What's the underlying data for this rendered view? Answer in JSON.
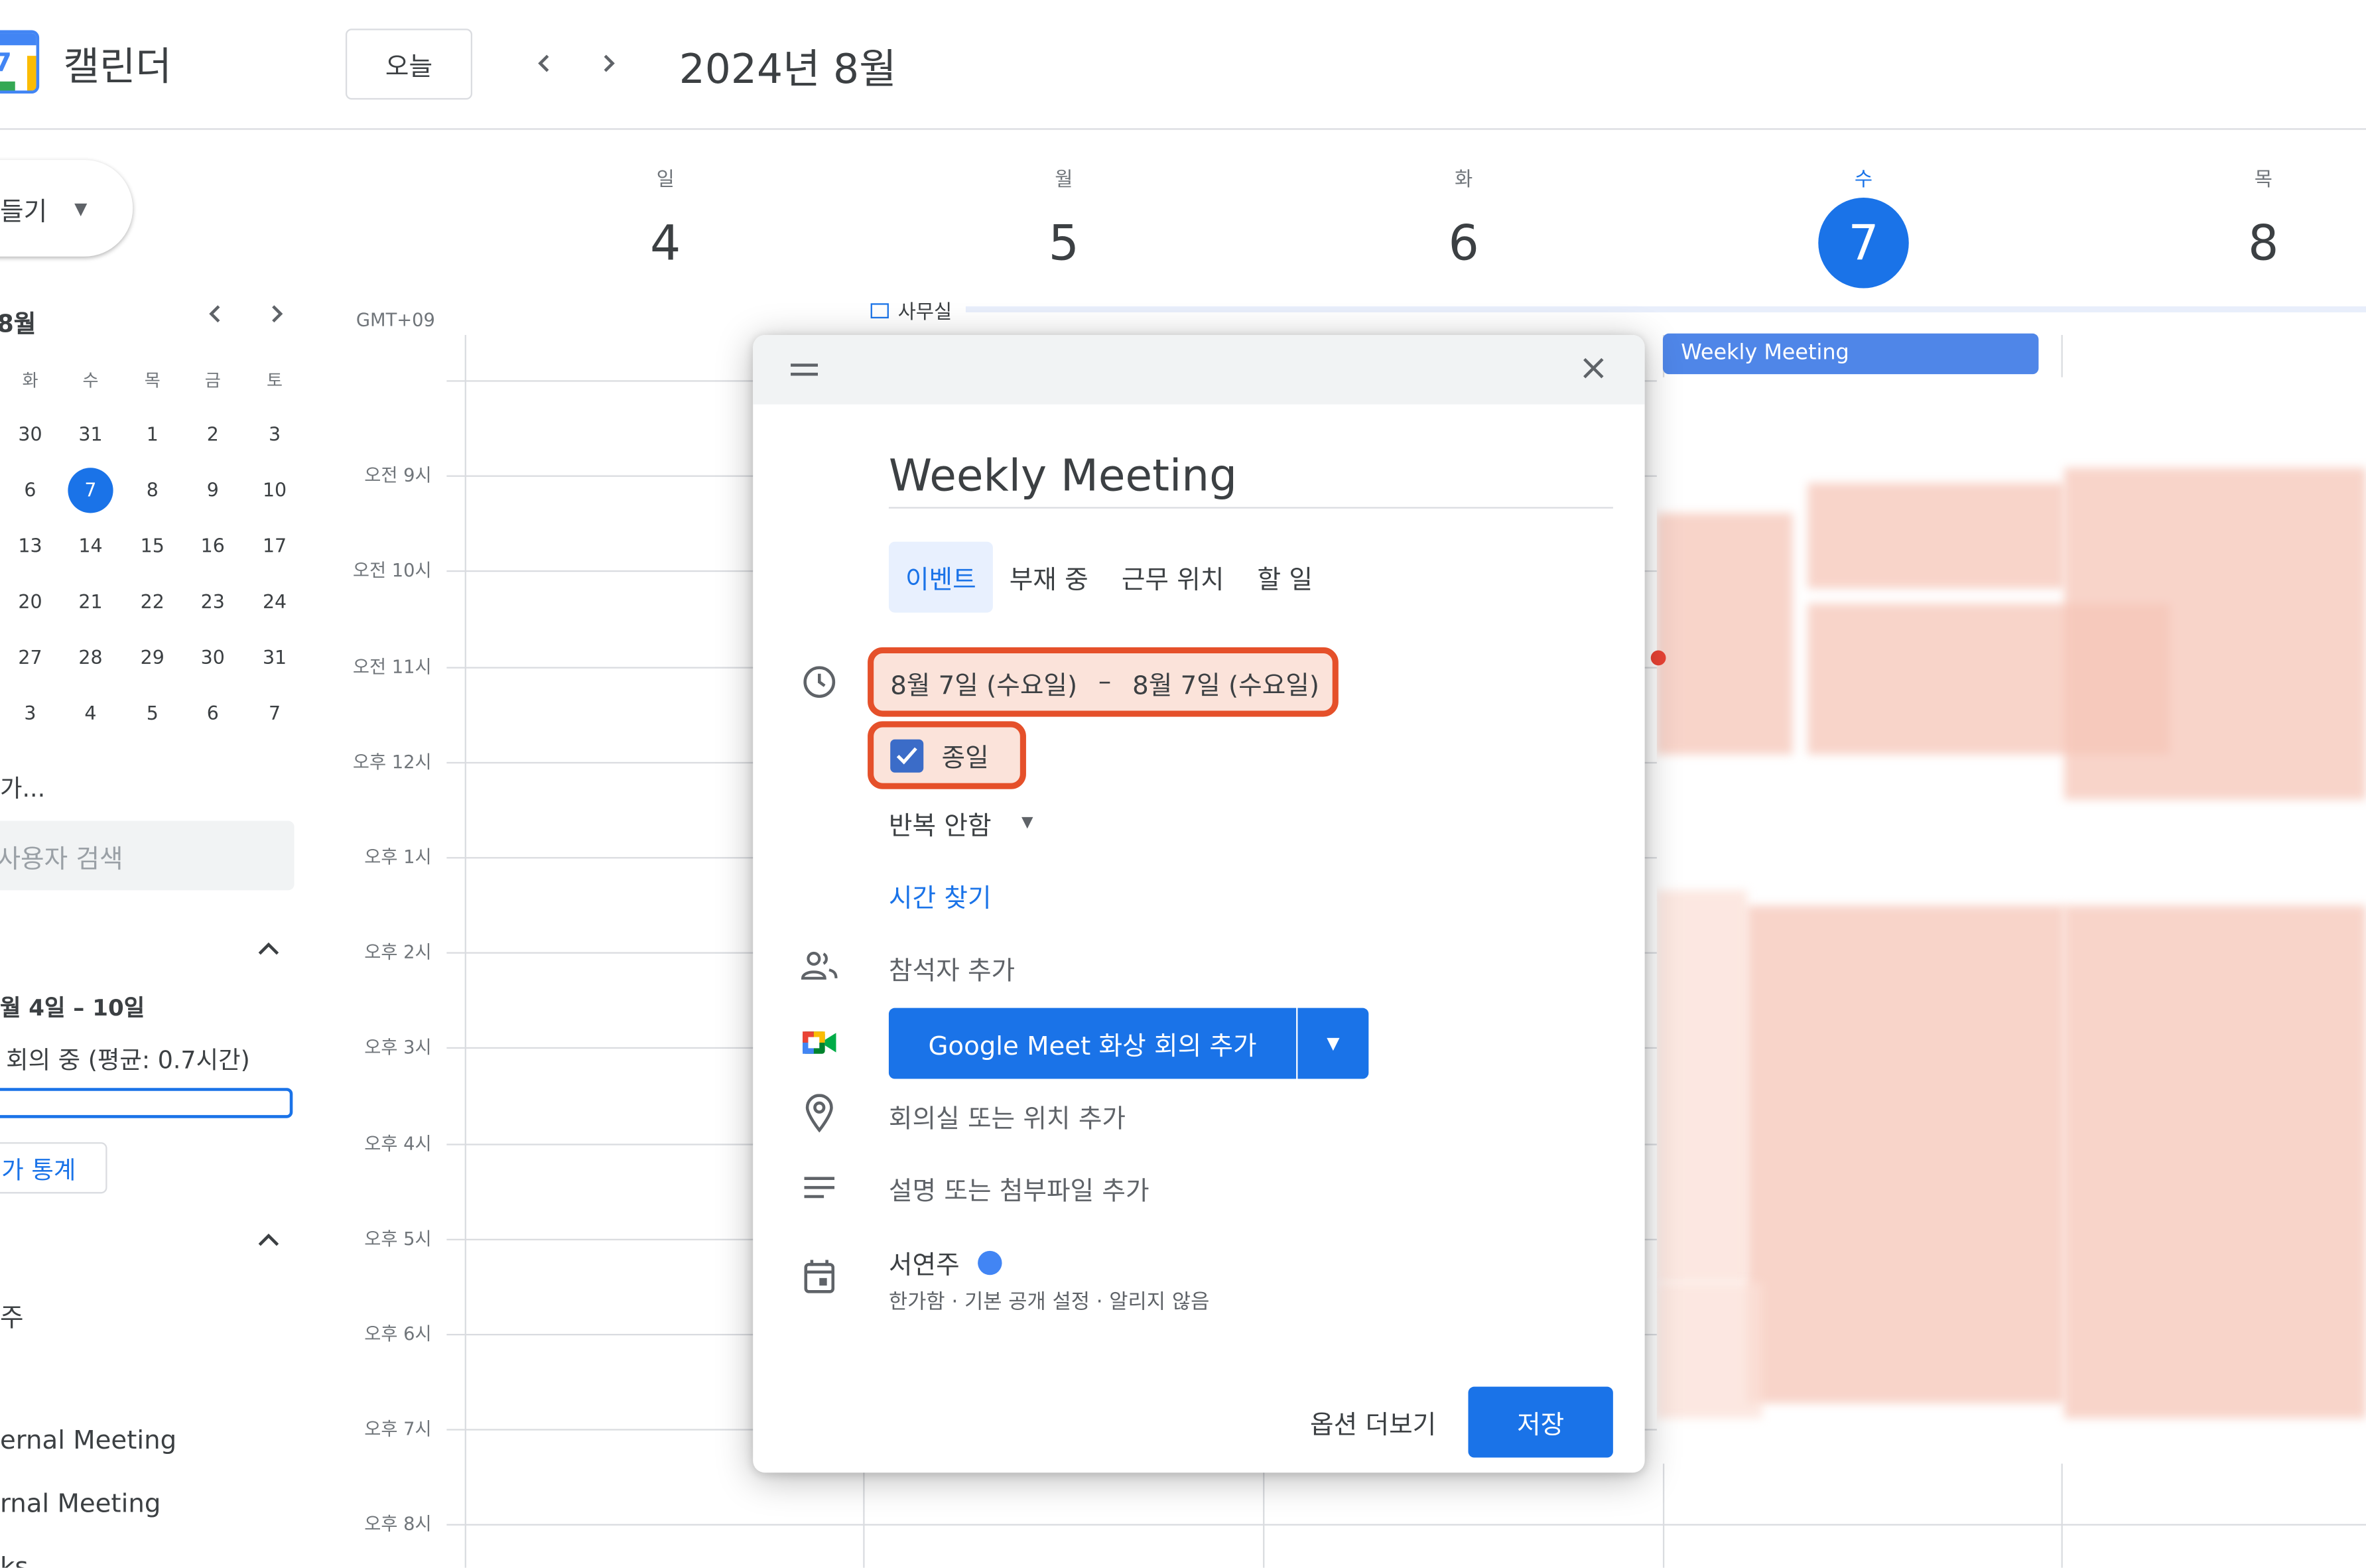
{
  "header": {
    "logo_number": "7",
    "app_title": "캘린더",
    "today_label": "오늘",
    "prev_icon": "chevron-left-icon",
    "next_icon": "chevron-right-icon",
    "month_title": "2024년 8월"
  },
  "sidebar": {
    "create_label": "들기",
    "mini_month": "8월",
    "weekday_headers": [
      "화",
      "수",
      "목",
      "금",
      "토"
    ],
    "weeks": [
      [
        "30",
        "31",
        "1",
        "2",
        "3"
      ],
      [
        "6",
        "7",
        "8",
        "9",
        "10"
      ],
      [
        "13",
        "14",
        "15",
        "16",
        "17"
      ],
      [
        "20",
        "21",
        "22",
        "23",
        "24"
      ],
      [
        "27",
        "28",
        "29",
        "30",
        "31"
      ],
      [
        "3",
        "4",
        "5",
        "6",
        "7"
      ]
    ],
    "selected_day": "7",
    "add_text": "가...",
    "search_placeholder": "사용자 검색",
    "insights_range": "월 4일 – 10일",
    "insights_meeting": "회의 중 (평균: 0.7시간)",
    "insights_progress": 0.02,
    "stats_label": "가 통계",
    "cal_item_1": "주",
    "cal_item_2": "ernal Meeting",
    "cal_item_3": "rnal Meeting",
    "cal_item_4": "ks"
  },
  "calendar": {
    "days": [
      {
        "dow": "일",
        "num": "4"
      },
      {
        "dow": "월",
        "num": "5"
      },
      {
        "dow": "화",
        "num": "6"
      },
      {
        "dow": "수",
        "num": "7",
        "today": true
      },
      {
        "dow": "목",
        "num": "8"
      }
    ],
    "timezone": "GMT+09",
    "office_label": "사무실",
    "hours": [
      "오전 9시",
      "오전 10시",
      "오전 11시",
      "오후 12시",
      "오후 1시",
      "오후 2시",
      "오후 3시",
      "오후 4시",
      "오후 5시",
      "오후 6시",
      "오후 7시",
      "오후 8시"
    ],
    "event_chip": "Weekly Meeting"
  },
  "dialog": {
    "title": "Weekly Meeting",
    "tabs": [
      "이벤트",
      "부재 중",
      "근무 위치",
      "할 일"
    ],
    "active_tab": "이벤트",
    "start_date": "8월 7일 (수요일)",
    "date_separator": "–",
    "end_date": "8월 7일 (수요일)",
    "all_day_label": "종일",
    "all_day_checked": true,
    "repeat_label": "반복 안함",
    "find_time_label": "시간 찾기",
    "guests_placeholder": "참석자 추가",
    "meet_label": "Google Meet 화상 회의 추가",
    "location_placeholder": "회의실 또는 위치 추가",
    "description_placeholder": "설명 또는 첨부파일 추가",
    "owner_name": "서연주",
    "owner_color": "#4285f4",
    "owner_details": "한가함 · 기본 공개 설정 · 알리지 않음",
    "more_options_label": "옵션 더보기",
    "save_label": "저장"
  },
  "colors": {
    "accent": "#1a73e8",
    "highlight_border": "#e5502a",
    "event_chip": "#4f86e8"
  }
}
